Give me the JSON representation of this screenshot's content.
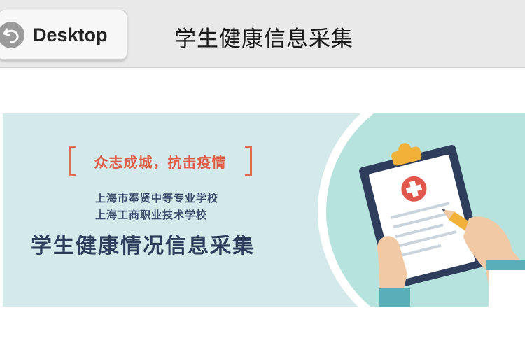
{
  "header": {
    "back_label": "Desktop",
    "title": "学生健康信息采集"
  },
  "banner": {
    "slogan": "众志成城，抗击疫情",
    "schools": [
      "上海市奉贤中等专业学校",
      "上海工商职业技术学校"
    ],
    "headline": "学生健康情况信息采集"
  },
  "colors": {
    "topbar_bg": "#e9e9e9",
    "banner_bg": "#d3e9ea",
    "slogan_red": "#e05a43",
    "headline_navy": "#2e3d5c"
  },
  "icons": [
    "back-arrow-icon",
    "clipboard-medical-icon"
  ]
}
